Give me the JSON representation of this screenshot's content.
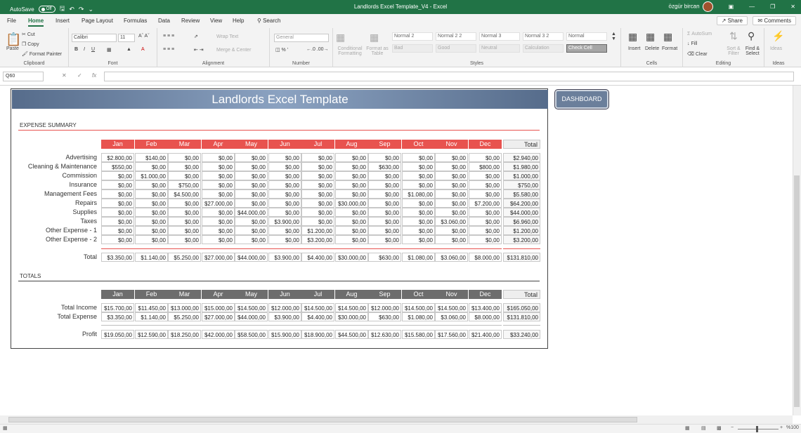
{
  "titlebar": {
    "autosave": "AutoSave",
    "autosave_state": "Off",
    "title": "Landlords Excel Template_V4  -  Excel",
    "user": "özgür bircan"
  },
  "tabs": [
    "File",
    "Home",
    "Insert",
    "Page Layout",
    "Formulas",
    "Data",
    "Review",
    "View",
    "Help"
  ],
  "search": "Search",
  "share": "Share",
  "comments": "Comments",
  "ribbon": {
    "clipboard": {
      "paste": "Paste",
      "cut": "Cut",
      "copy": "Copy",
      "format_painter": "Format Painter",
      "label": "Clipboard"
    },
    "font": {
      "name": "Calibri",
      "size": "11",
      "label": "Font"
    },
    "alignment": {
      "wrap": "Wrap Text",
      "merge": "Merge & Center",
      "label": "Alignment"
    },
    "number": {
      "format": "General",
      "label": "Number"
    },
    "styles": {
      "cond": "Conditional Formatting",
      "table": "Format as Table",
      "cells_row1": [
        "Normal 2",
        "Normal 2 2",
        "Normal 3",
        "Normal 3 2",
        "Normal"
      ],
      "cells_row2": [
        "Bad",
        "Good",
        "Neutral",
        "Calculation",
        "Check Cell"
      ],
      "label": "Styles"
    },
    "cells": {
      "insert": "Insert",
      "delete": "Delete",
      "format": "Format",
      "label": "Cells"
    },
    "editing": {
      "autosum": "AutoSum",
      "fill": "Fill",
      "clear": "Clear",
      "sort": "Sort & Filter",
      "find": "Find & Select",
      "label": "Editing"
    },
    "ideas": {
      "ideas": "Ideas",
      "label": "Ideas"
    }
  },
  "formula_bar": {
    "name_box": "Q60",
    "fx": "fx"
  },
  "sheet": {
    "banner": "Landlords Excel Template",
    "dashboard_button": "DASHBOARD",
    "months": [
      "Jan",
      "Feb",
      "Mar",
      "Apr",
      "May",
      "Jun",
      "Jul",
      "Aug",
      "Sep",
      "Oct",
      "Nov",
      "Dec"
    ],
    "total_label": "Total",
    "expense": {
      "title": "EXPENSE SUMMARY",
      "header_color": "#e8534f",
      "rows": [
        {
          "label": "Advertising",
          "values": [
            "$2.800,00",
            "$140,00",
            "$0,00",
            "$0,00",
            "$0,00",
            "$0,00",
            "$0,00",
            "$0,00",
            "$0,00",
            "$0,00",
            "$0,00",
            "$0,00"
          ],
          "total": "$2.940,00"
        },
        {
          "label": "Cleaning & Maintenance",
          "values": [
            "$550,00",
            "$0,00",
            "$0,00",
            "$0,00",
            "$0,00",
            "$0,00",
            "$0,00",
            "$0,00",
            "$630,00",
            "$0,00",
            "$0,00",
            "$800,00"
          ],
          "total": "$1.980,00"
        },
        {
          "label": "Commission",
          "values": [
            "$0,00",
            "$1.000,00",
            "$0,00",
            "$0,00",
            "$0,00",
            "$0,00",
            "$0,00",
            "$0,00",
            "$0,00",
            "$0,00",
            "$0,00",
            "$0,00"
          ],
          "total": "$1.000,00"
        },
        {
          "label": "Insurance",
          "values": [
            "$0,00",
            "$0,00",
            "$750,00",
            "$0,00",
            "$0,00",
            "$0,00",
            "$0,00",
            "$0,00",
            "$0,00",
            "$0,00",
            "$0,00",
            "$0,00"
          ],
          "total": "$750,00"
        },
        {
          "label": "Management Fees",
          "values": [
            "$0,00",
            "$0,00",
            "$4.500,00",
            "$0,00",
            "$0,00",
            "$0,00",
            "$0,00",
            "$0,00",
            "$0,00",
            "$1.080,00",
            "$0,00",
            "$0,00"
          ],
          "total": "$5.580,00"
        },
        {
          "label": "Repairs",
          "values": [
            "$0,00",
            "$0,00",
            "$0,00",
            "$27.000,00",
            "$0,00",
            "$0,00",
            "$0,00",
            "$30.000,00",
            "$0,00",
            "$0,00",
            "$0,00",
            "$7.200,00"
          ],
          "total": "$64.200,00"
        },
        {
          "label": "Supplies",
          "values": [
            "$0,00",
            "$0,00",
            "$0,00",
            "$0,00",
            "$44.000,00",
            "$0,00",
            "$0,00",
            "$0,00",
            "$0,00",
            "$0,00",
            "$0,00",
            "$0,00"
          ],
          "total": "$44.000,00"
        },
        {
          "label": "Taxes",
          "values": [
            "$0,00",
            "$0,00",
            "$0,00",
            "$0,00",
            "$0,00",
            "$3.900,00",
            "$0,00",
            "$0,00",
            "$0,00",
            "$0,00",
            "$3.060,00",
            "$0,00"
          ],
          "total": "$6.960,00"
        },
        {
          "label": "Other Expense - 1",
          "values": [
            "$0,00",
            "$0,00",
            "$0,00",
            "$0,00",
            "$0,00",
            "$0,00",
            "$1.200,00",
            "$0,00",
            "$0,00",
            "$0,00",
            "$0,00",
            "$0,00"
          ],
          "total": "$1.200,00"
        },
        {
          "label": "Other Expense - 2",
          "values": [
            "$0,00",
            "$0,00",
            "$0,00",
            "$0,00",
            "$0,00",
            "$0,00",
            "$3.200,00",
            "$0,00",
            "$0,00",
            "$0,00",
            "$0,00",
            "$0,00"
          ],
          "total": "$3.200,00"
        }
      ],
      "total_row": {
        "label": "Total",
        "values": [
          "$3.350,00",
          "$1.140,00",
          "$5.250,00",
          "$27.000,00",
          "$44.000,00",
          "$3.900,00",
          "$4.400,00",
          "$30.000,00",
          "$630,00",
          "$1.080,00",
          "$3.060,00",
          "$8.000,00"
        ],
        "total": "$131.810,00"
      }
    },
    "totals": {
      "title": "TOTALS",
      "header_color": "#6d6d6d",
      "rows": [
        {
          "label": "Total Income",
          "values": [
            "$15.700,00",
            "$11.450,00",
            "$13.000,00",
            "$15.000,00",
            "$14.500,00",
            "$12.000,00",
            "$14.500,00",
            "$14.500,00",
            "$12.000,00",
            "$14.500,00",
            "$14.500,00",
            "$13.400,00"
          ],
          "total": "$165.050,00"
        },
        {
          "label": "Total Expense",
          "values": [
            "$3.350,00",
            "$1.140,00",
            "$5.250,00",
            "$27.000,00",
            "$44.000,00",
            "$3.900,00",
            "$4.400,00",
            "$30.000,00",
            "$630,00",
            "$1.080,00",
            "$3.060,00",
            "$8.000,00"
          ],
          "total": "$131.810,00"
        }
      ],
      "profit_row": {
        "label": "Profit",
        "values": [
          "$19.050,00",
          "$12.590,00",
          "$18.250,00",
          "$42.000,00",
          "$58.500,00",
          "$15.900,00",
          "$18.900,00",
          "$44.500,00",
          "$12.630,00",
          "$15.580,00",
          "$17.560,00",
          "$21.400,00"
        ],
        "total": "$33.240,00"
      }
    }
  },
  "status": {
    "zoom": "%100"
  }
}
